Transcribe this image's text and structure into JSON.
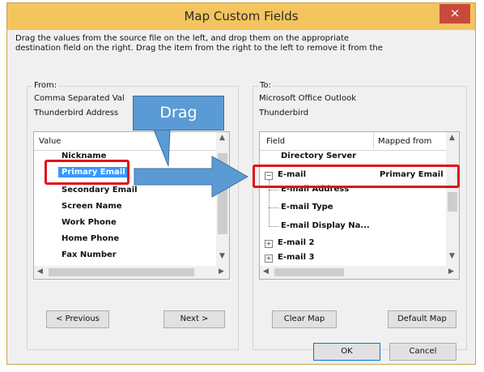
{
  "dialog": {
    "title": "Map Custom Fields",
    "close_glyph": "×",
    "instructions_line1": "Drag the values from the source file on the left, and drop them on the appropriate",
    "instructions_line2": "destination field on the right.  Drag the item from the right to the left to remove it from the"
  },
  "from": {
    "label": "From:",
    "line1": "Comma Separated Val",
    "line2": "Thunderbird Address",
    "column_header": "Value",
    "items": [
      "Nickname",
      "Primary Email",
      "Secondary Email",
      "Screen Name",
      "Work Phone",
      "Home Phone",
      "Fax Number"
    ]
  },
  "to": {
    "label": "To:",
    "line1": "Microsoft Office Outlook",
    "line2": "Thunderbird",
    "column_field": "Field",
    "column_mapped": "Mapped from",
    "rows": [
      {
        "field": "Directory Server",
        "mapped": ""
      },
      {
        "field": "E-mail",
        "mapped": "Primary Email",
        "expander": "⊟"
      },
      {
        "field": "E-mail Address",
        "mapped": ""
      },
      {
        "field": "E-mail Type",
        "mapped": ""
      },
      {
        "field": "E-mail Display Na...",
        "mapped": ""
      },
      {
        "field": "E-mail 2",
        "mapped": "",
        "expander": "⊞"
      },
      {
        "field": "E-mail 3",
        "mapped": "",
        "expander": "⊞"
      }
    ]
  },
  "buttons": {
    "previous": "< Previous",
    "next": "Next >",
    "clear_map": "Clear Map",
    "default_map": "Default Map",
    "ok": "OK",
    "cancel": "Cancel"
  },
  "annotation": {
    "callout_text": "Drag"
  },
  "colors": {
    "titlebar": "#f4c45f",
    "close": "#c94a3b",
    "highlight": "#3399ff",
    "annotation_red": "#e0101a",
    "callout_blue": "#5b9bd5"
  }
}
